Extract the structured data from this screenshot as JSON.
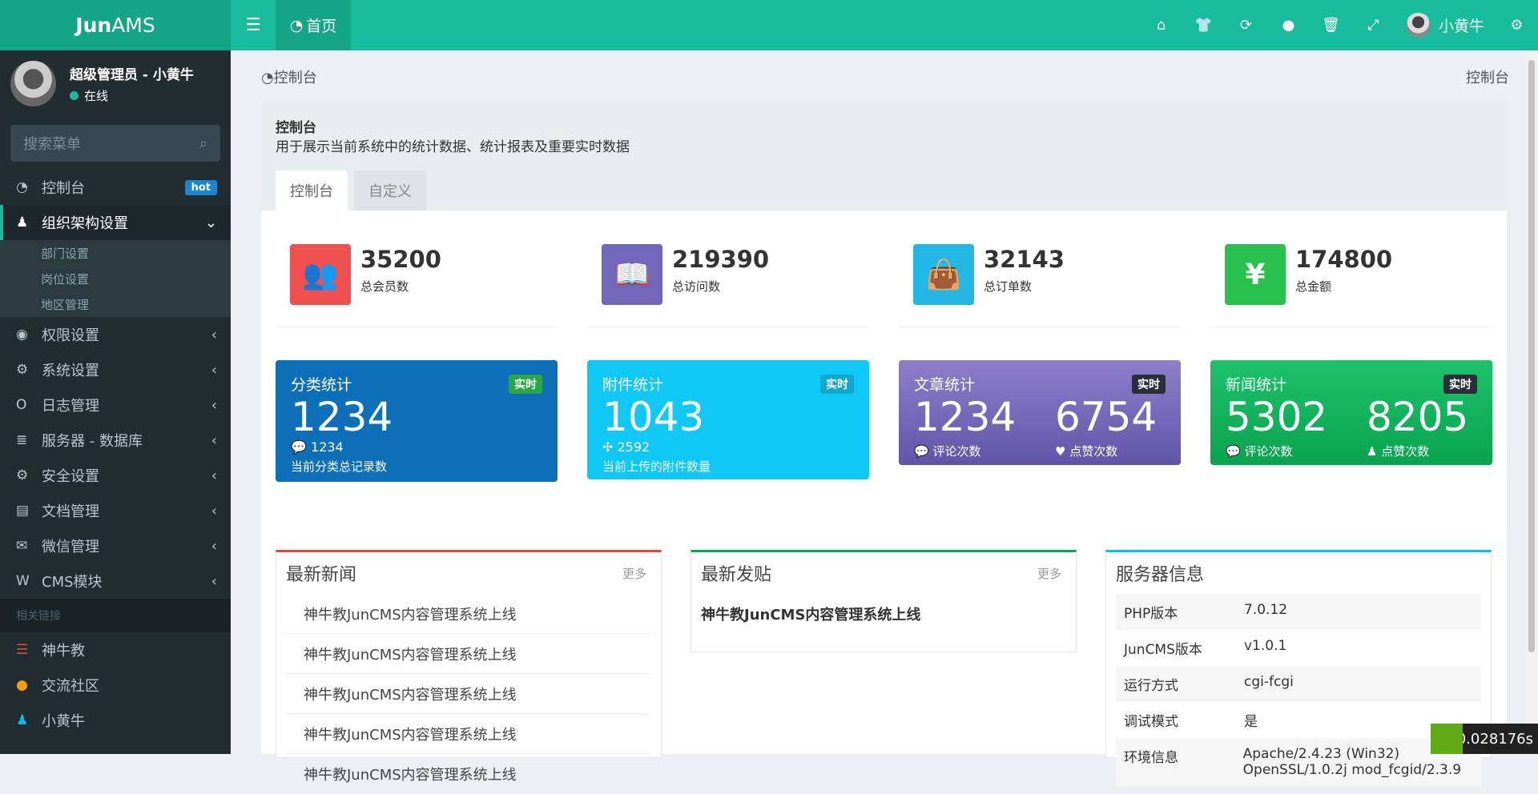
{
  "header": {
    "logo_bold": "Jun",
    "logo_rest": "AMS",
    "home_tab": "首页",
    "user": "小黄牛",
    "icons": [
      "home-icon",
      "shirt-icon",
      "refresh-icon",
      "bomb-icon",
      "trash-icon",
      "fullscreen-icon"
    ]
  },
  "sidebar": {
    "user_name": "超级管理员 - 小黄牛",
    "status": "在线",
    "search_placeholder": "搜索菜单",
    "items": [
      {
        "label": "控制台",
        "badge": "hot"
      },
      {
        "label": "组织架构设置",
        "sub": [
          "部门设置",
          "岗位设置",
          "地区管理"
        ]
      },
      {
        "label": "权限设置"
      },
      {
        "label": "系统设置"
      },
      {
        "label": "日志管理"
      },
      {
        "label": "服务器 - 数据库"
      },
      {
        "label": "安全设置"
      },
      {
        "label": "文档管理"
      },
      {
        "label": "微信管理"
      },
      {
        "label": "CMS模块"
      }
    ],
    "section": "相关链接",
    "links": [
      {
        "label": "神牛教",
        "color": "#dd4b39"
      },
      {
        "label": "交流社区",
        "color": "#f39c12"
      },
      {
        "label": "小黄牛",
        "color": "#00c0ef"
      }
    ]
  },
  "breadcrumb": {
    "left": "控制台",
    "right": "控制台"
  },
  "panel": {
    "title": "控制台",
    "desc": "用于展示当前系统中的统计数据、统计报表及重要实时数据",
    "tabs": [
      "控制台",
      "自定义"
    ]
  },
  "stats": [
    {
      "value": "35200",
      "label": "总会员数",
      "color": "#f05050"
    },
    {
      "value": "219390",
      "label": "总访问数",
      "color": "#7266ba"
    },
    {
      "value": "32143",
      "label": "总订单数",
      "color": "#23b7e5"
    },
    {
      "value": "174800",
      "label": "总金额",
      "color": "#27c24c",
      "symbol": "¥"
    }
  ],
  "cards": [
    {
      "title": "分类统计",
      "badge": "实时",
      "big": "1234",
      "small": "1234",
      "desc": "当前分类总记录数"
    },
    {
      "title": "附件统计",
      "badge": "实时",
      "big": "1043",
      "small": "2592",
      "desc": "当前上传的附件数量"
    },
    {
      "title": "文章统计",
      "badge": "实时",
      "big1": "1234",
      "lab1": "评论次数",
      "big2": "6754",
      "lab2": "点赞次数"
    },
    {
      "title": "新闻统计",
      "badge": "实时",
      "big1": "5302",
      "lab1": "评论次数",
      "big2": "8205",
      "lab2": "点赞次数"
    }
  ],
  "news": {
    "title": "最新新闻",
    "more": "更多",
    "items": [
      "神牛教JunCMS内容管理系统上线",
      "神牛教JunCMS内容管理系统上线",
      "神牛教JunCMS内容管理系统上线",
      "神牛教JunCMS内容管理系统上线",
      "神牛教JunCMS内容管理系统上线"
    ]
  },
  "posts": {
    "title": "最新发贴",
    "more": "更多",
    "items": [
      "神牛教JunCMS内容管理系统上线"
    ]
  },
  "server": {
    "title": "服务器信息",
    "rows": [
      {
        "k": "PHP版本",
        "v": "7.0.12"
      },
      {
        "k": "JunCMS版本",
        "v": "v1.0.1"
      },
      {
        "k": "运行方式",
        "v": "cgi-fcgi"
      },
      {
        "k": "调试模式",
        "v": "是"
      },
      {
        "k": "环境信息",
        "v": "Apache/2.4.23 (Win32) OpenSSL/1.0.2j mod_fcgid/2.3.9"
      }
    ]
  },
  "timer": "0.028176s"
}
